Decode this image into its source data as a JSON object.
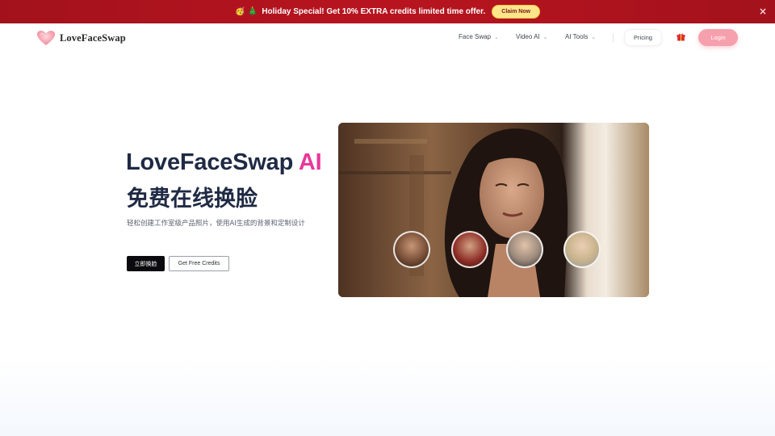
{
  "promo": {
    "emoji": "🥳 🎄",
    "text": "Holiday Special! Get 10% EXTRA credits limited time offer.",
    "cta": "Claim Now",
    "close": "×"
  },
  "header": {
    "logo_text": "LoveFaceSwap",
    "nav": [
      {
        "label": "Face Swap",
        "icon": "chevron-down-icon"
      },
      {
        "label": "Video AI",
        "icon": "chevron-down-icon"
      },
      {
        "label": "AI Tools",
        "icon": "chevron-down-icon"
      }
    ],
    "pricing": "Pricing",
    "gift_icon": "gift-icon",
    "login": "Login"
  },
  "hero": {
    "title_main": "LoveFaceSwap",
    "title_accent": "AI",
    "title_line2": "免费在线换脸",
    "description": "轻松创建工作室级产品照片，使用AI生成的背景和定制设计",
    "primary_button": "立即换脸",
    "secondary_button": "Get Free Credits"
  },
  "colors": {
    "promo_bg": "#b8141f",
    "accent_pink": "#e8379a",
    "login_bg": "#f6a0ad",
    "claim_bg": "#fde68a",
    "title_color": "#1f2a44"
  }
}
